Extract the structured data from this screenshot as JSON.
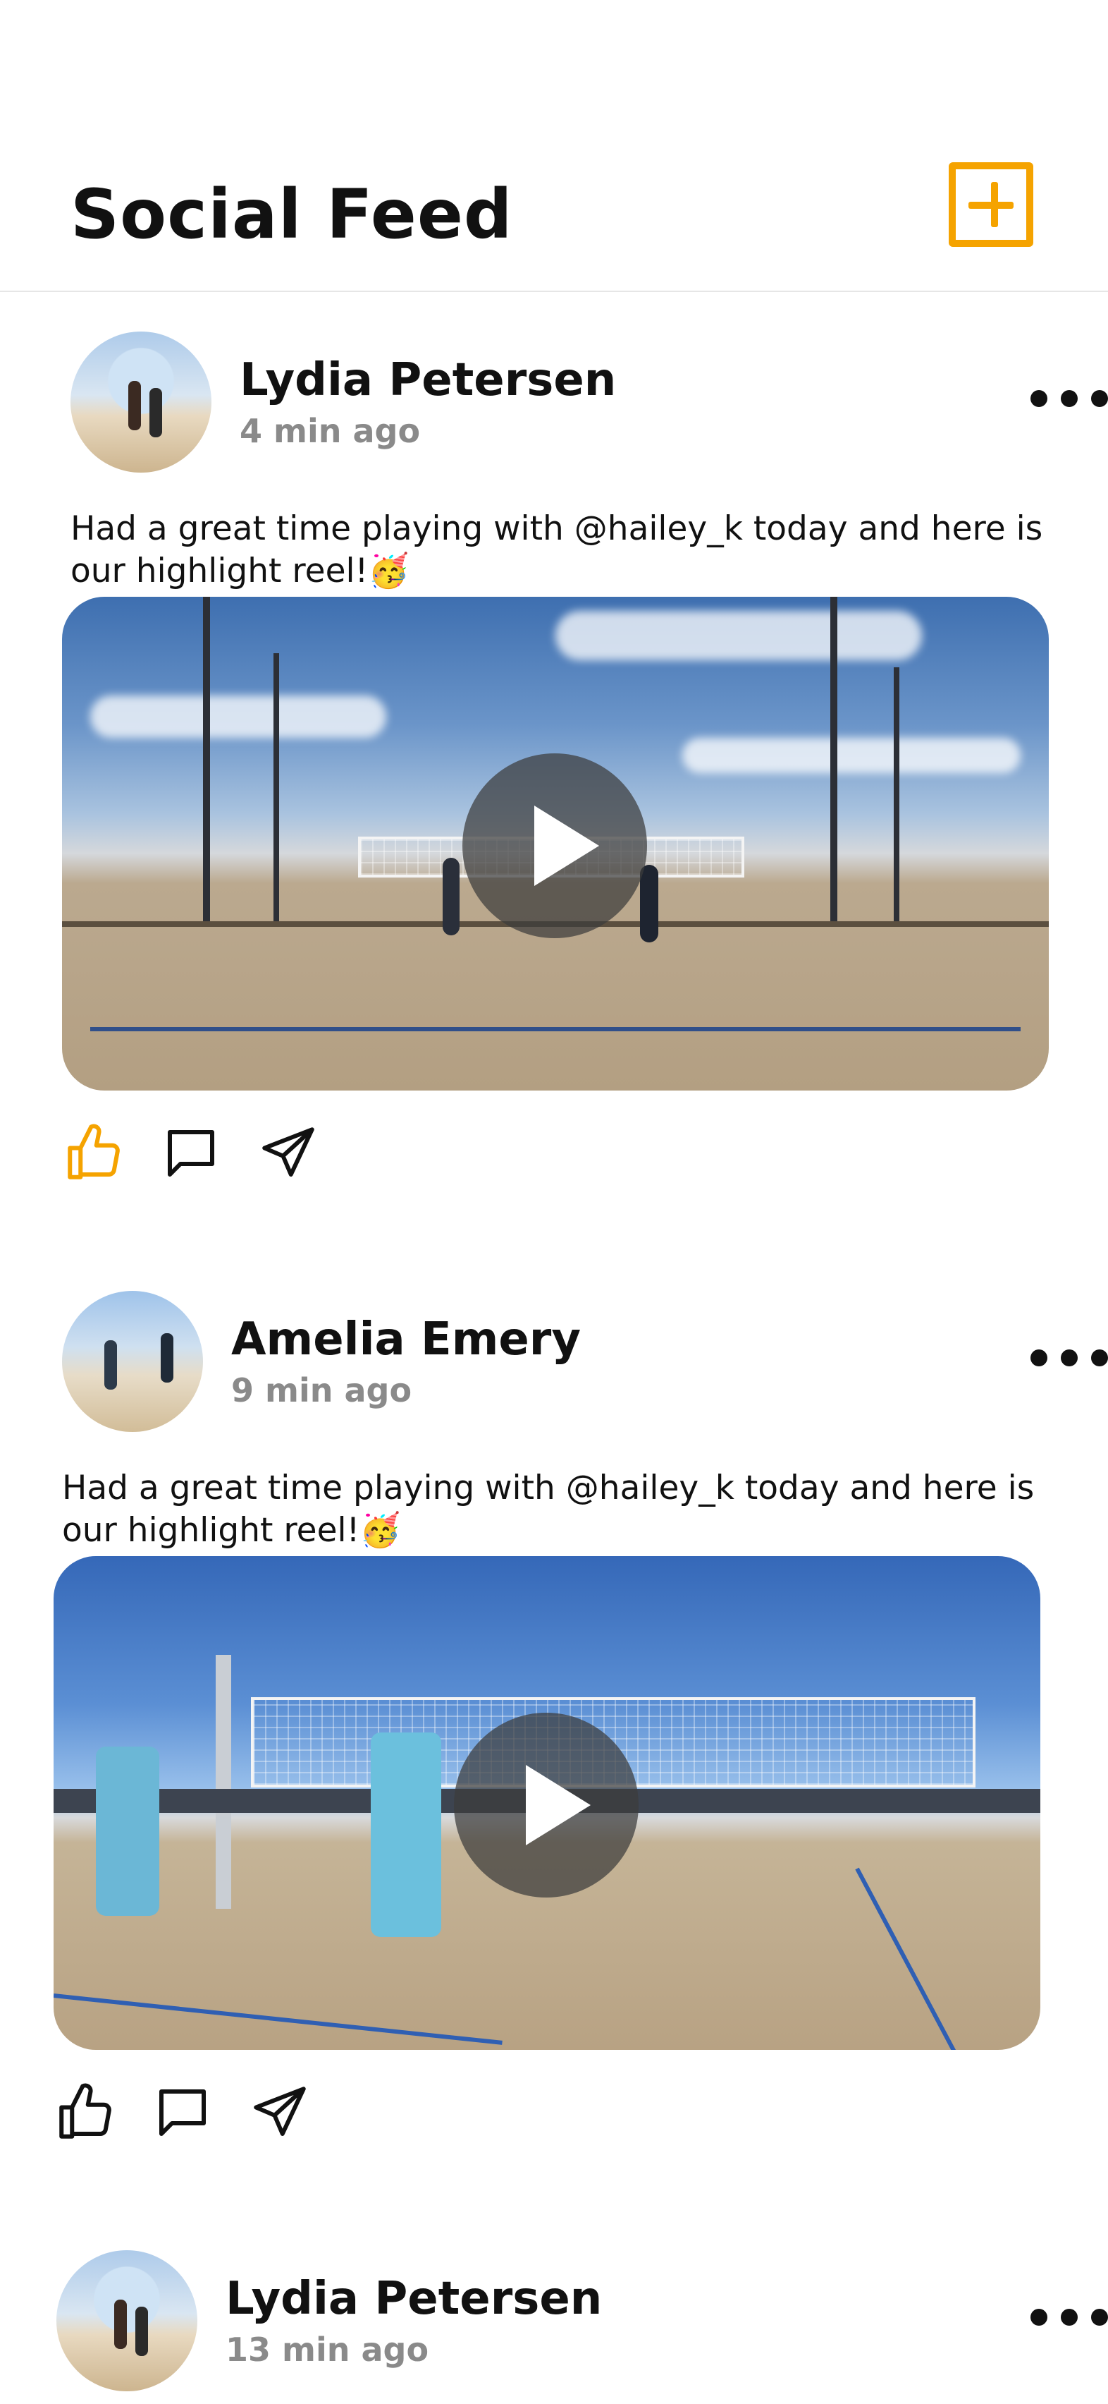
{
  "header": {
    "title": "Social Feed",
    "add_icon": "plus-square-icon",
    "accent": "#f5a300"
  },
  "posts": [
    {
      "author": "Lydia Petersen",
      "time": "4 min ago",
      "caption": "Had a great time playing with @hailey_k today and here is our highlight reel!🥳",
      "liked": true
    },
    {
      "author": "Amelia Emery",
      "time": "9 min ago",
      "caption": "Had a great time playing with @hailey_k today and here is our highlight reel!🥳",
      "liked": false
    },
    {
      "author": "Lydia Petersen",
      "time": "13 min ago"
    }
  ],
  "icons": {
    "like": "thumbs-up-icon",
    "comment": "comment-icon",
    "share": "send-icon",
    "more": "more-horizontal-icon",
    "play": "play-icon"
  }
}
